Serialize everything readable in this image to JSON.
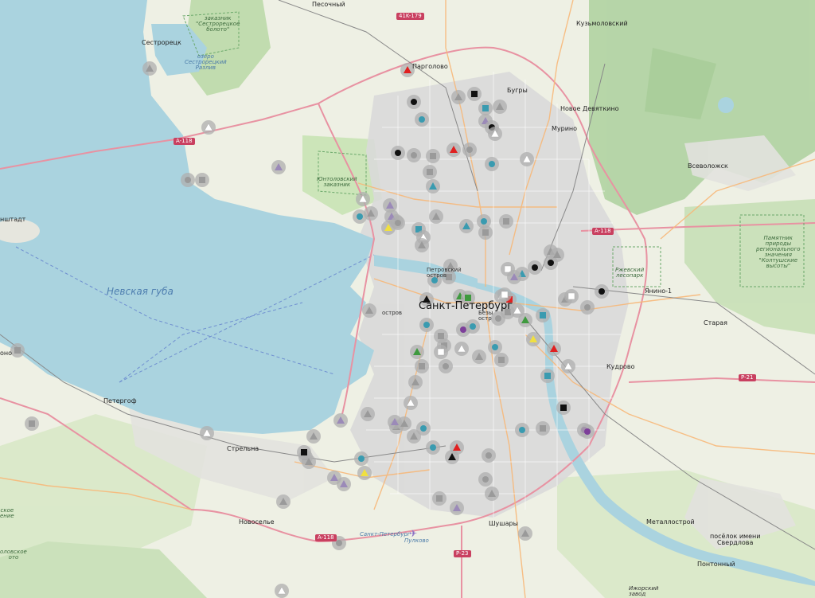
{
  "water_labels": [
    {
      "id": "neva-bay",
      "text": "Невская губа",
      "cls": "bigwater"
    },
    {
      "id": "sestroretsk-lake",
      "text": "озеро\nСестрорецкий\nРазлив",
      "cls": "water"
    }
  ],
  "place_labels": [
    {
      "id": "pesochny",
      "text": "Песочный",
      "cls": "town"
    },
    {
      "id": "sestroretsk",
      "text": "Сестрорецк",
      "cls": "town"
    },
    {
      "id": "kuzmolovsky",
      "text": "Кузьмоловский",
      "cls": "town"
    },
    {
      "id": "pargolovo",
      "text": "Парголово",
      "cls": "town"
    },
    {
      "id": "bugry",
      "text": "Бугры",
      "cls": "town"
    },
    {
      "id": "novoe-devyatkino",
      "text": "Новое Девяткино",
      "cls": "town"
    },
    {
      "id": "murino",
      "text": "Мурино",
      "cls": "town"
    },
    {
      "id": "vsevolozhsk",
      "text": "Всеволожск",
      "cls": "town"
    },
    {
      "id": "kronshtadt",
      "text": "нштадт",
      "cls": "town"
    },
    {
      "id": "spb",
      "text": "Санкт-Петербург",
      "cls": "city"
    },
    {
      "id": "yanino",
      "text": "Янино-1",
      "cls": "town"
    },
    {
      "id": "staraya",
      "text": "Старая",
      "cls": "town"
    },
    {
      "id": "kudrovo",
      "text": "Кудрово",
      "cls": "town"
    },
    {
      "id": "lomonosov",
      "text": "оно",
      "cls": "town"
    },
    {
      "id": "peterhof",
      "text": "Петергоф",
      "cls": "town"
    },
    {
      "id": "strelna",
      "text": "Стрельна",
      "cls": "town"
    },
    {
      "id": "novoselye",
      "text": "Новоселье",
      "cls": "town"
    },
    {
      "id": "shushary",
      "text": "Шушары",
      "cls": "town"
    },
    {
      "id": "metallostroy",
      "text": "Металлострой",
      "cls": "town"
    },
    {
      "id": "sverdlov",
      "text": "посёлок имени\nСвердлова",
      "cls": "town"
    },
    {
      "id": "pontonny",
      "text": "Понтонный",
      "cls": "town"
    },
    {
      "id": "petrovsky",
      "text": "Петровский\nостров",
      "cls": "small"
    },
    {
      "id": "bezymyanny",
      "text": "Безы\nостр",
      "cls": "small"
    },
    {
      "id": "ostrov",
      "text": "остров",
      "cls": "small"
    },
    {
      "id": "pulkovo",
      "text": "Пулково",
      "cls": "water"
    },
    {
      "id": "spb-airport",
      "text": "Санкт-Петербург",
      "cls": "water"
    },
    {
      "id": "izhorsky",
      "text": "Ижорский\nзавод",
      "cls": "small"
    }
  ],
  "park_labels": [
    {
      "id": "sestroretsk-bog",
      "text": "заказник\n\"Сестрорецкое\nболото\""
    },
    {
      "id": "yuntolovsky",
      "text": "Юнтоловский\nзаказник"
    },
    {
      "id": "rzhevsky",
      "text": "Ржевский\nлесопарк"
    },
    {
      "id": "koltushi",
      "text": "Памятник\nприроды\nрегионального\nзначения\n\"Колтушские\nвысоты\""
    },
    {
      "id": "south-nature",
      "text": "ское\nение"
    },
    {
      "id": "south-bog",
      "text": "оловское\nото"
    }
  ],
  "road_shields": [
    {
      "id": "a118-west",
      "text": "A-118",
      "cls": "red"
    },
    {
      "id": "41k179",
      "text": "41K-179",
      "cls": "red"
    },
    {
      "id": "a118-east",
      "text": "A-118",
      "cls": "red"
    },
    {
      "id": "r21",
      "text": "P-21",
      "cls": "red"
    },
    {
      "id": "a118-south",
      "text": "A-118",
      "cls": "red"
    },
    {
      "id": "r23",
      "text": "P-23",
      "cls": "red"
    }
  ],
  "colors": {
    "water": "#aad3df",
    "land": "#f2efe9",
    "forest": "#add19e",
    "green": "#cdebb0",
    "urban": "#dddddd",
    "road": "#f7b879",
    "motorway": "#e892a2",
    "marker_bg": "#b9b9b9",
    "sym_red": "#e02020",
    "sym_black": "#111111",
    "sym_white": "#ffffff",
    "sym_gray": "#9a9a9a",
    "sym_darkgray": "#7a7a7a",
    "sym_teal": "#3a9bb0",
    "sym_green": "#3f9a3f",
    "sym_purple": "#7d3f9a",
    "sym_lavender": "#9b8ab8",
    "sym_yellow": "#f0e040"
  },
  "markers": [
    {
      "s": "gray-tri"
    },
    {
      "s": "white-tri"
    },
    {
      "s": "gray-sq"
    },
    {
      "s": "lavender-tri"
    },
    {
      "s": "red-tri"
    },
    {
      "s": "black-dot"
    },
    {
      "s": "teal-dot"
    },
    {
      "s": "gray-tri"
    },
    {
      "s": "black-sq"
    },
    {
      "s": "gray-tri"
    },
    {
      "s": "teal-sq"
    },
    {
      "s": "lavender-tri"
    },
    {
      "s": "black-dot"
    },
    {
      "s": "white-tri"
    },
    {
      "s": "black-dot"
    },
    {
      "s": "gray-dot"
    },
    {
      "s": "gray-sq"
    },
    {
      "s": "red-tri"
    },
    {
      "s": "gray-dot"
    },
    {
      "s": "teal-dot"
    },
    {
      "s": "gray-sq"
    },
    {
      "s": "teal-tri"
    },
    {
      "s": "lavender-tri"
    },
    {
      "s": "white-tri"
    },
    {
      "s": "gray-tri"
    },
    {
      "s": "white-tri"
    },
    {
      "s": "teal-dot"
    },
    {
      "s": "gray-tri"
    },
    {
      "s": "lavender-tri"
    },
    {
      "s": "yellow-tri"
    },
    {
      "s": "gray-dot"
    },
    {
      "s": "teal-sq"
    },
    {
      "s": "gray-tri"
    },
    {
      "s": "teal-tri"
    },
    {
      "s": "gray-sq"
    },
    {
      "s": "white-tri"
    },
    {
      "s": "teal-dot"
    },
    {
      "s": "gray-sq"
    },
    {
      "s": "gray-tri"
    },
    {
      "s": "black-dot"
    },
    {
      "s": "black-dot"
    },
    {
      "s": "black-dot"
    },
    {
      "s": "white-sq"
    },
    {
      "s": "teal-tri"
    },
    {
      "s": "lavender-tri"
    },
    {
      "s": "gray-tri"
    },
    {
      "s": "red-sq"
    },
    {
      "s": "white-tri"
    },
    {
      "s": "black-tri"
    },
    {
      "s": "green-tri"
    },
    {
      "s": "green-sq"
    },
    {
      "s": "teal-dot"
    },
    {
      "s": "gray-sq"
    },
    {
      "s": "gray-tri"
    },
    {
      "s": "purple-dot"
    },
    {
      "s": "gray-dot"
    },
    {
      "s": "teal-dot"
    },
    {
      "s": "gray-sq"
    },
    {
      "s": "white-tri"
    },
    {
      "s": "green-tri"
    },
    {
      "s": "teal-sq"
    },
    {
      "s": "gray-tri"
    },
    {
      "s": "white-sq"
    },
    {
      "s": "gray-dot"
    },
    {
      "s": "yellow-tri"
    },
    {
      "s": "red-tri"
    },
    {
      "s": "green-tri"
    },
    {
      "s": "teal-dot"
    },
    {
      "s": "gray-sq"
    },
    {
      "s": "white-tri"
    },
    {
      "s": "teal-dot"
    },
    {
      "s": "gray-tri"
    },
    {
      "s": "gray-sq"
    },
    {
      "s": "gray-dot"
    },
    {
      "s": "gray-sq"
    },
    {
      "s": "white-tri"
    },
    {
      "s": "gray-tri"
    },
    {
      "s": "teal-sq"
    },
    {
      "s": "lavender-tri"
    },
    {
      "s": "gray-tri"
    },
    {
      "s": "purple-dot"
    },
    {
      "s": "teal-dot"
    },
    {
      "s": "black-sq"
    },
    {
      "s": "gray-sq"
    },
    {
      "s": "black-tri"
    },
    {
      "s": "red-tri"
    },
    {
      "s": "teal-dot"
    },
    {
      "s": "gray-tri"
    },
    {
      "s": "lavender-tri"
    },
    {
      "s": "lavender-tri"
    },
    {
      "s": "yellow-tri"
    },
    {
      "s": "gray-dot"
    },
    {
      "s": "gray-tri"
    },
    {
      "s": "lavender-tri"
    },
    {
      "s": "gray-sq"
    },
    {
      "s": "gray-tri"
    },
    {
      "s": "teal-dot"
    },
    {
      "s": "gray-tri"
    },
    {
      "s": "gray-dot"
    },
    {
      "s": "white-tri"
    },
    {
      "s": "gray-tri"
    },
    {
      "s": "gray-tri"
    },
    {
      "s": "gray-dot"
    },
    {
      "s": "gray-sq"
    },
    {
      "s": "black-sq"
    },
    {
      "s": "gray-sq"
    },
    {
      "s": "white-sq"
    },
    {
      "s": "gray-tri"
    },
    {
      "s": "purple-dot"
    },
    {
      "s": "gray-tri"
    },
    {
      "s": "teal-dot"
    },
    {
      "s": "gray-tri"
    },
    {
      "s": "lavender-tri"
    },
    {
      "s": "white-tri"
    },
    {
      "s": "gray-dot"
    },
    {
      "s": "white-tri"
    },
    {
      "s": "gray-tri"
    },
    {
      "s": "gray-sq"
    },
    {
      "s": "white-sq"
    },
    {
      "s": "gray-tri"
    }
  ]
}
